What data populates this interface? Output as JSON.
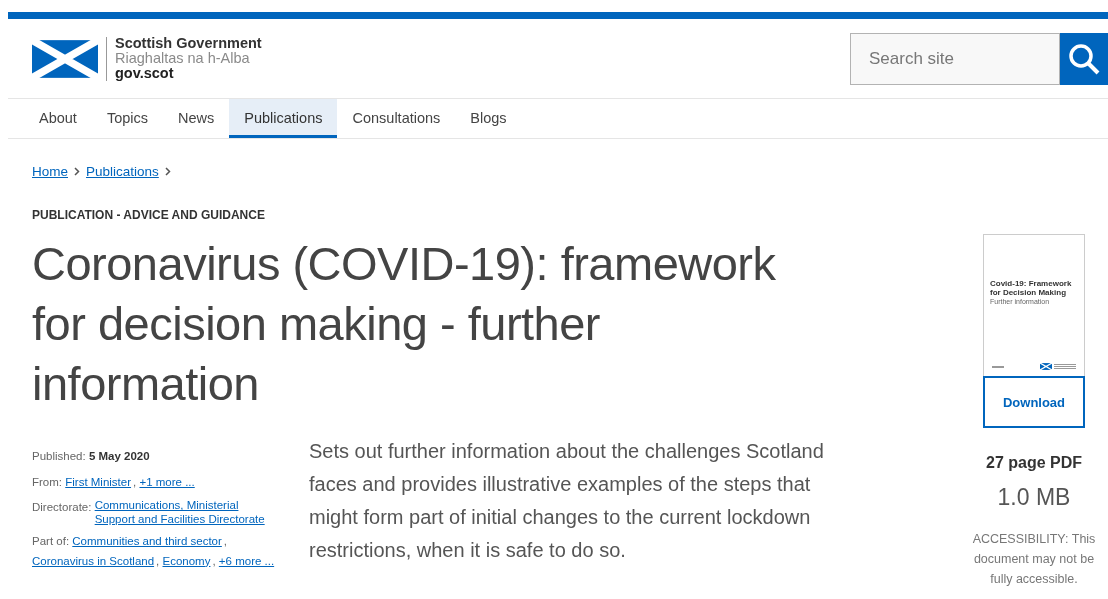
{
  "header": {
    "logo": {
      "name": "Scottish Government",
      "gaelic": "Riaghaltas na h-Alba",
      "domain": "gov.scot"
    },
    "search": {
      "placeholder": "Search site"
    }
  },
  "nav": [
    {
      "label": "About",
      "selected": false
    },
    {
      "label": "Topics",
      "selected": false
    },
    {
      "label": "News",
      "selected": false
    },
    {
      "label": "Publications",
      "selected": true
    },
    {
      "label": "Consultations",
      "selected": false
    },
    {
      "label": "Blogs",
      "selected": false
    }
  ],
  "breadcrumb": [
    "Home",
    "Publications"
  ],
  "category": "PUBLICATION - ADVICE AND GUIDANCE",
  "title": "Coronavirus (COVID-19): framework for decision making - further information",
  "meta": [
    {
      "kind": "text",
      "label": "Published:",
      "value": "5 May 2020"
    },
    {
      "kind": "links",
      "label": "From:",
      "separator": ",",
      "links": [
        "First Minister",
        "+1 more ..."
      ]
    },
    {
      "kind": "links",
      "label": "Directorate:",
      "links": [
        "Communications, Ministerial Support and Facilities Directorate"
      ]
    },
    {
      "kind": "links",
      "label": "Part of:",
      "separator": ",",
      "links": [
        "Communities and third sector",
        "Coronavirus in Scotland",
        "Economy",
        "+6 more ..."
      ]
    }
  ],
  "summary": "Sets out further information about the challenges Scotland faces and provides illustrative examples of the steps that might form part of initial changes to the current lockdown restrictions, when it is safe to do so.",
  "document": {
    "cover_title": "Covid-19: Framework for Decision Making",
    "cover_subtitle": "Further information",
    "download": "Download",
    "pages": "27 page PDF",
    "size": "1.0 MB",
    "accessibility": "ACCESSIBILITY: This document may not be fully accessible."
  }
}
